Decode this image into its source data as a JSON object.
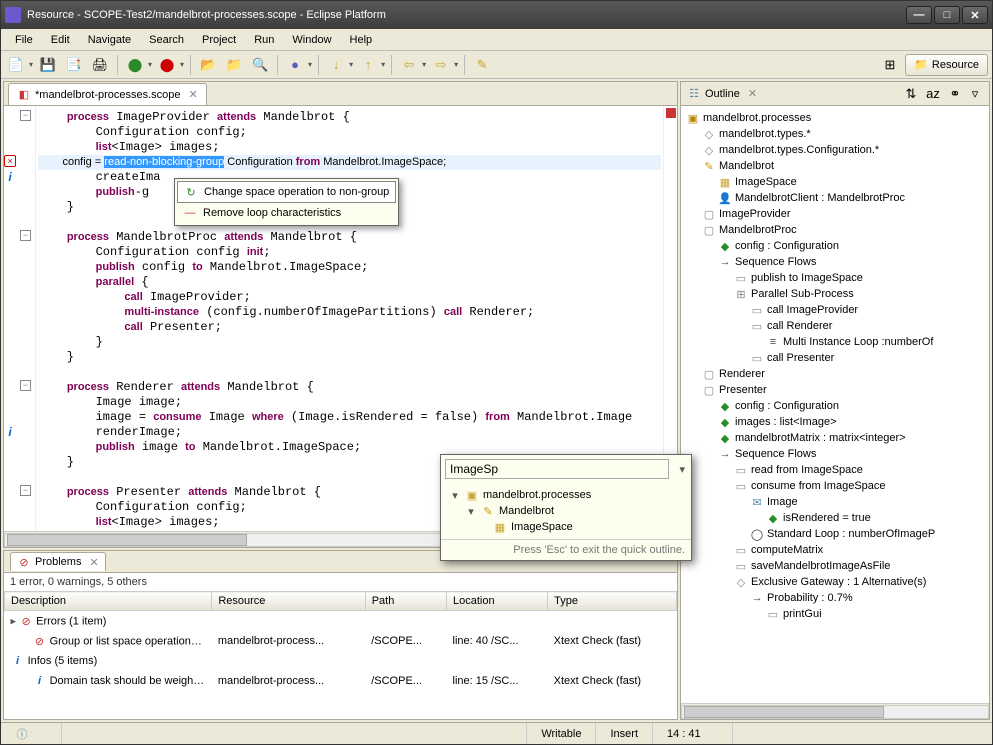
{
  "window": {
    "title": "Resource - SCOPE-Test2/mandelbrot-processes.scope - Eclipse Platform"
  },
  "menu": {
    "items": [
      "File",
      "Edit",
      "Navigate",
      "Search",
      "Project",
      "Run",
      "Window",
      "Help"
    ]
  },
  "perspective": {
    "label": "Resource"
  },
  "editor": {
    "tab_label": "*mandelbrot-processes.scope",
    "selection_text": "read-non-blocking-group",
    "line_after_sel": " Configuration ",
    "line_after_from": " Mandelbrot.ImageSpace;",
    "lines_pre": [
      "    process ImageProvider attends Mandelbrot {",
      "        Configuration config;",
      "        list<Image> images;"
    ],
    "line_cfg_start": "        config = ",
    "lines_post1": [
      "        createIma",
      "        publish-g"
    ],
    "lines_block2": [
      "    }",
      "",
      "    process MandelbrotProc attends Mandelbrot {",
      "        Configuration config init;",
      "        publish config to Mandelbrot.ImageSpace;",
      "        parallel {",
      "            call ImageProvider;",
      "            multi-instance (config.numberOfImagePartitions) call Renderer;",
      "            call Presenter;",
      "        }",
      "    }",
      "",
      "    process Renderer attends Mandelbrot {",
      "        Image image;",
      "        image = consume Image where (Image.isRendered = false) from Mandelbrot.Image",
      "        renderImage;",
      "        publish image to Mandelbrot.ImageSpace;",
      "    }",
      "",
      "    process Presenter attends Mandelbrot {",
      "        Configuration config;",
      "        list<Image> images;"
    ],
    "kw_from": "from",
    "kw_process": "process",
    "kw_attends": "attends"
  },
  "quickfix": {
    "item1": "Change space operation to non-group",
    "item2": "Remove loop characteristics"
  },
  "quick_outline": {
    "filter": "ImageSp",
    "row1": "mandelbrot.processes",
    "row2": "Mandelbrot",
    "row3": "ImageSpace",
    "hint": "Press 'Esc' to exit the quick outline.",
    "dropdown_glyph": "▾"
  },
  "outline": {
    "title": "Outline",
    "items": [
      {
        "ind": 0,
        "icon": "pkg",
        "label": "mandelbrot.processes"
      },
      {
        "ind": 1,
        "icon": "diamond",
        "label": "mandelbrot.types.*"
      },
      {
        "ind": 1,
        "icon": "diamond",
        "label": "mandelbrot.types.Configuration.*"
      },
      {
        "ind": 1,
        "icon": "pencil",
        "label": "Mandelbrot"
      },
      {
        "ind": 2,
        "icon": "folder",
        "label": "ImageSpace"
      },
      {
        "ind": 2,
        "icon": "person",
        "label": "MandelbrotClient : MandelbrotProc"
      },
      {
        "ind": 1,
        "icon": "square",
        "label": "ImageProvider"
      },
      {
        "ind": 1,
        "icon": "square",
        "label": "MandelbrotProc"
      },
      {
        "ind": 2,
        "icon": "diamond-g",
        "label": "config : Configuration"
      },
      {
        "ind": 2,
        "icon": "arrow",
        "label": "Sequence Flows"
      },
      {
        "ind": 3,
        "icon": "box",
        "label": "publish to ImageSpace"
      },
      {
        "ind": 3,
        "icon": "plus",
        "label": "Parallel Sub-Process"
      },
      {
        "ind": 4,
        "icon": "box",
        "label": "call ImageProvider"
      },
      {
        "ind": 4,
        "icon": "box",
        "label": "call Renderer"
      },
      {
        "ind": 5,
        "icon": "bars",
        "label": "Multi Instance Loop :numberOf"
      },
      {
        "ind": 4,
        "icon": "box",
        "label": "call Presenter"
      },
      {
        "ind": 1,
        "icon": "square",
        "label": "Renderer"
      },
      {
        "ind": 1,
        "icon": "square",
        "label": "Presenter"
      },
      {
        "ind": 2,
        "icon": "diamond-g",
        "label": "config : Configuration"
      },
      {
        "ind": 2,
        "icon": "diamond-g",
        "label": "images : list<Image>"
      },
      {
        "ind": 2,
        "icon": "diamond-g",
        "label": "mandelbrotMatrix : matrix<integer>"
      },
      {
        "ind": 2,
        "icon": "arrow",
        "label": "Sequence Flows"
      },
      {
        "ind": 3,
        "icon": "box",
        "label": "read  from ImageSpace"
      },
      {
        "ind": 3,
        "icon": "box",
        "label": "consume from ImageSpace"
      },
      {
        "ind": 4,
        "icon": "env",
        "label": "Image"
      },
      {
        "ind": 5,
        "icon": "diamond-g",
        "label": "isRendered = true"
      },
      {
        "ind": 4,
        "icon": "loop",
        "label": "Standard Loop : numberOfImageP"
      },
      {
        "ind": 3,
        "icon": "box",
        "label": "computeMatrix"
      },
      {
        "ind": 3,
        "icon": "box",
        "label": "saveMandelbrotImageAsFile"
      },
      {
        "ind": 3,
        "icon": "gate",
        "label": "Exclusive Gateway : 1 Alternative(s)"
      },
      {
        "ind": 4,
        "icon": "arrow",
        "label": "Probability : 0.7%"
      },
      {
        "ind": 5,
        "icon": "box",
        "label": "printGui"
      }
    ]
  },
  "problems": {
    "title": "Problems",
    "summary": "1 error, 0 warnings, 5 others",
    "headers": [
      "Description",
      "Resource",
      "Path",
      "Location",
      "Type"
    ],
    "rows": [
      {
        "group": true,
        "cols": [
          "Errors (1 item)",
          "",
          "",
          "",
          ""
        ]
      },
      {
        "group": false,
        "icon": "err",
        "cols": [
          "Group or list space operations mus",
          "mandelbrot-process...",
          "/SCOPE...",
          "line: 40 /SC...",
          "Xtext Check (fast)"
        ]
      },
      {
        "group": true,
        "icon": "info-i",
        "cols": [
          "Infos (5 items)",
          "",
          "",
          "",
          ""
        ]
      },
      {
        "group": false,
        "icon": "info",
        "cols": [
          "Domain task should be weighted.",
          "mandelbrot-process...",
          "/SCOPE...",
          "line: 15 /SC...",
          "Xtext Check (fast)"
        ]
      }
    ]
  },
  "status": {
    "writable": "Writable",
    "insert": "Insert",
    "pos": "14 : 41"
  }
}
